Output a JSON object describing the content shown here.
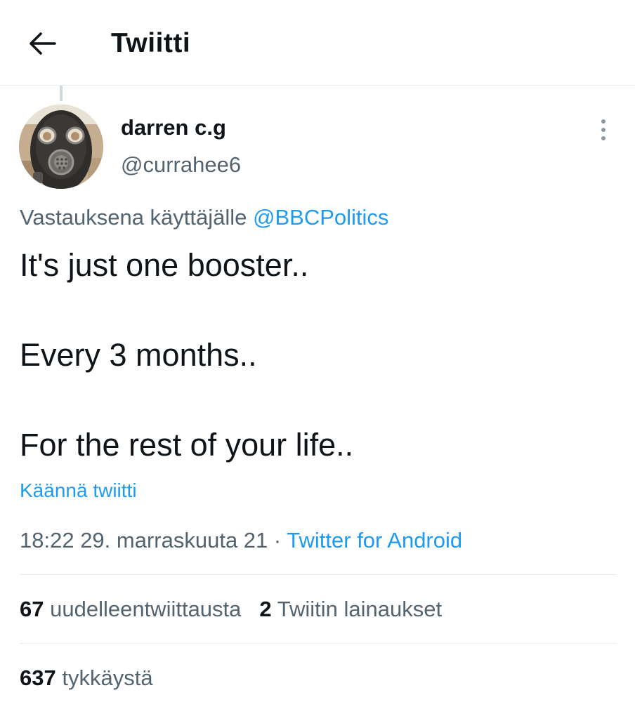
{
  "header": {
    "title": "Twiitti",
    "back_icon": "arrow-left-icon"
  },
  "tweet": {
    "author": {
      "display_name": "darren c.g",
      "handle": "@currahee6",
      "avatar": "gas-mask-avatar"
    },
    "more_icon": "vertical-ellipsis-icon",
    "reply_context": {
      "prefix": "Vastauksena käyttäjälle",
      "mention": "@BBCPolitics"
    },
    "lines": [
      "It's just one booster..",
      "Every 3 months..",
      "For the rest of your life.."
    ],
    "translate_label": "Käännä twiitti",
    "timestamp": "18:22 29. marraskuuta 21",
    "separator": "·",
    "source": "Twitter for Android"
  },
  "stats": {
    "retweets": {
      "count": "67",
      "label": "uudelleentwiittausta"
    },
    "quotes": {
      "count": "2",
      "label": "Twiitin lainaukset"
    },
    "likes": {
      "count": "637",
      "label": "tykkäystä"
    }
  },
  "colors": {
    "accent": "#1d9bf0",
    "text": "#0f1419",
    "secondary": "#536471",
    "divider": "#e6ecf0"
  }
}
